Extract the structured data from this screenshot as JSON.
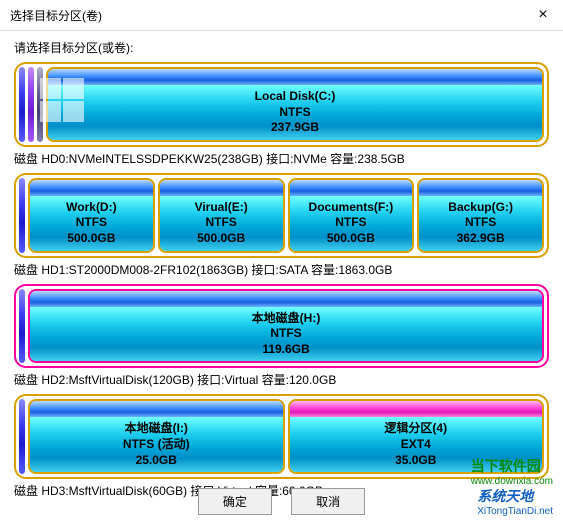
{
  "window": {
    "title": "选择目标分区(卷)",
    "close": "×"
  },
  "prompt": "请选择目标分区(或卷):",
  "disks": [
    {
      "bars": [
        "blue",
        "purple",
        "dark"
      ],
      "parts": [
        {
          "name": "Local Disk(C:)",
          "fs": "NTFS",
          "size": "237.9GB",
          "style": "normal",
          "hasLogo": true
        }
      ],
      "info": "磁盘 HD0:NVMeINTELSSDPEKKW25(238GB) 接口:NVMe 容量:238.5GB"
    },
    {
      "bars": [
        "blue"
      ],
      "parts": [
        {
          "name": "Work(D:)",
          "fs": "NTFS",
          "size": "500.0GB",
          "style": "normal"
        },
        {
          "name": "Virual(E:)",
          "fs": "NTFS",
          "size": "500.0GB",
          "style": "normal"
        },
        {
          "name": "Documents(F:)",
          "fs": "NTFS",
          "size": "500.0GB",
          "style": "normal"
        },
        {
          "name": "Backup(G:)",
          "fs": "NTFS",
          "size": "362.9GB",
          "style": "normal"
        }
      ],
      "info": "磁盘 HD1:ST2000DM008-2FR102(1863GB) 接口:SATA 容量:1863.0GB"
    },
    {
      "bars": [
        "blue"
      ],
      "selected": true,
      "parts": [
        {
          "name": "本地磁盘(H:)",
          "fs": "NTFS",
          "size": "119.6GB",
          "style": "normal",
          "selected": true
        }
      ],
      "info": "磁盘 HD2:MsftVirtualDisk(120GB) 接口:Virtual 容量:120.0GB"
    },
    {
      "bars": [
        "blue"
      ],
      "parts": [
        {
          "name": "本地磁盘(I:)",
          "fs": "NTFS (活动)",
          "size": "25.0GB",
          "style": "normal"
        },
        {
          "name": "逻辑分区(4)",
          "fs": "EXT4",
          "size": "35.0GB",
          "style": "magenta"
        }
      ],
      "info": "磁盘 HD3:MsftVirtualDisk(60GB) 接口:Virtual 容量:60.0GB"
    }
  ],
  "buttons": {
    "ok": "确定",
    "cancel": "取消"
  },
  "watermark1": {
    "main": "当下软件园",
    "sub": "www.downxia.com"
  },
  "watermark2": {
    "main": "系统天地",
    "sub": "XiTongTianDi.net"
  }
}
